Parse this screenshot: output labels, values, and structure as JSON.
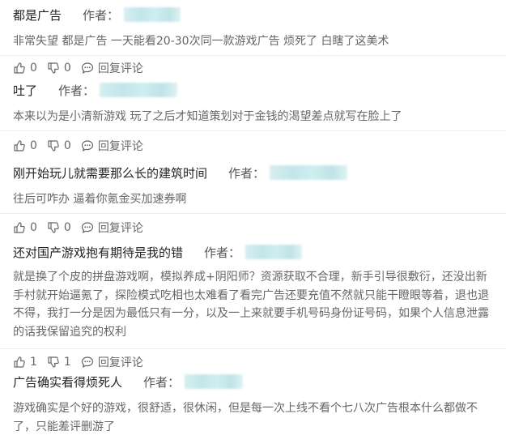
{
  "labels": {
    "author": "作者：",
    "reply": "回复评论"
  },
  "comments": [
    {
      "title": "都是广告",
      "body": "非常失望 都是广告 一天能看20-30次同一款游戏广告 烦死了 白瞎了这美术",
      "likes": "0",
      "dislikes": "0"
    },
    {
      "title": "吐了",
      "body": "本来以为是小清新游戏 玩了之后才知道策划对于金钱的渴望差点就写在脸上了",
      "likes": "0",
      "dislikes": "0"
    },
    {
      "title": "刚开始玩儿就需要那么长的建筑时间",
      "body": "往后可咋办 逼着你氪金买加速券啊",
      "likes": "0",
      "dislikes": "0"
    },
    {
      "title": "还对国产游戏抱有期待是我的错",
      "body": "就是换了个皮的拼盘游戏啊，模拟养成+阴阳师？资源获取不合理，新手引导很敷衍，还没出新手村就开始逼氪了，探险模式吃相也太难看了看完广告还要充值不然就只能干瞪眼等着，退也退不得，我打一分是因为最低只有一分，以及一上来就要手机号码身份证号码，如果个人信息泄露的话我保留追究的权利",
      "likes": "1",
      "dislikes": "1"
    },
    {
      "title": "广告确实看得烦死人",
      "body": "游戏确实是个好的游戏，很舒适，很休闲，但是每一次上线不看个七八次广告根本什么都做不了，只能差评删游了",
      "likes": "",
      "dislikes": ""
    }
  ]
}
